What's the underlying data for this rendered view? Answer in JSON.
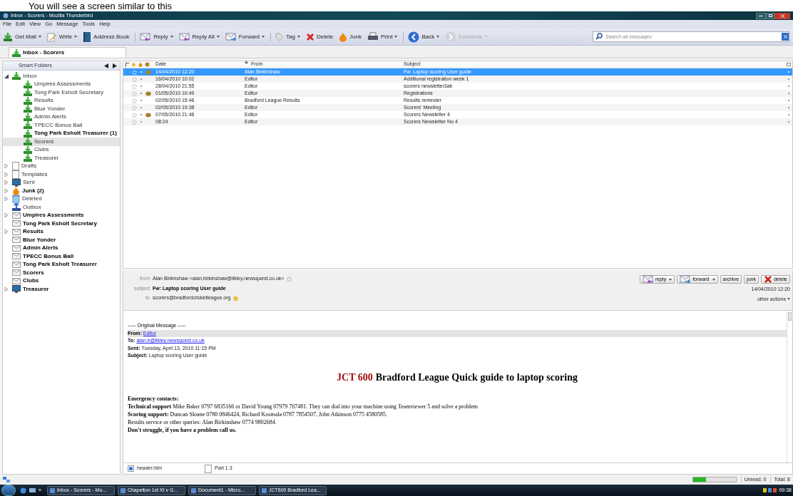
{
  "caption": "You will see a screen similar to this",
  "window": {
    "title": "Inbox - Scorers - Mozilla Thunderbird"
  },
  "menu": [
    "File",
    "Edit",
    "View",
    "Go",
    "Message",
    "Tools",
    "Help"
  ],
  "toolbar": [
    {
      "label": "Get Mail",
      "kind": "getmail",
      "dropdown": true,
      "disabled": false
    },
    {
      "label": "Write",
      "kind": "write",
      "dropdown": true,
      "disabled": false
    },
    {
      "label": "Address Book",
      "kind": "book",
      "dropdown": false,
      "disabled": false
    },
    {
      "label": "Reply",
      "kind": "reply",
      "dropdown": true,
      "disabled": false
    },
    {
      "label": "Reply All",
      "kind": "replyall",
      "dropdown": true,
      "disabled": false
    },
    {
      "label": "Forward",
      "kind": "forward",
      "dropdown": true,
      "disabled": false
    },
    {
      "label": "Tag",
      "kind": "tag",
      "dropdown": true,
      "disabled": false
    },
    {
      "label": "Delete",
      "kind": "delete",
      "dropdown": false,
      "disabled": false
    },
    {
      "label": "Junk",
      "kind": "junk",
      "dropdown": false,
      "disabled": false
    },
    {
      "label": "Print",
      "kind": "print",
      "dropdown": true,
      "disabled": false
    },
    {
      "label": "Back",
      "kind": "back",
      "dropdown": true,
      "disabled": false
    },
    {
      "label": "Forwards",
      "kind": "fwd",
      "dropdown": true,
      "disabled": true
    }
  ],
  "search": {
    "placeholder": "Search all messages"
  },
  "tabs": [
    {
      "label": "Inbox - Scorers",
      "selected": true
    }
  ],
  "folder_pane": {
    "title": "Smart Folders"
  },
  "folders": [
    {
      "name": "Inbox",
      "kind": "inbox",
      "bold": false,
      "selected": false,
      "expanded": true,
      "children": [
        {
          "name": "Umpires Assessments",
          "kind": "inbox",
          "bold": false,
          "selected": false
        },
        {
          "name": "Tong Park Esholt Secretary",
          "kind": "inbox",
          "bold": false,
          "selected": false
        },
        {
          "name": "Results",
          "kind": "inbox",
          "bold": false,
          "selected": false
        },
        {
          "name": "Blue Yonder",
          "kind": "inbox",
          "bold": false,
          "selected": false
        },
        {
          "name": "Admin Alerts",
          "kind": "inbox",
          "bold": false,
          "selected": false
        },
        {
          "name": "TPECC Bonus Ball",
          "kind": "inbox",
          "bold": false,
          "selected": false
        },
        {
          "name": "Tong Park Esholt Treasurer (1)",
          "kind": "inbox",
          "bold": true,
          "selected": false
        },
        {
          "name": "Scorers",
          "kind": "inbox",
          "bold": false,
          "selected": true
        },
        {
          "name": "Clubs",
          "kind": "inbox",
          "bold": false,
          "selected": false
        },
        {
          "name": "Treasurer",
          "kind": "inbox",
          "bold": false,
          "selected": false
        }
      ]
    },
    {
      "name": "Drafts",
      "kind": "page",
      "bold": false,
      "selected": false,
      "expanded": false
    },
    {
      "name": "Templates",
      "kind": "page",
      "bold": false,
      "selected": false,
      "expanded": false
    },
    {
      "name": "Sent",
      "kind": "sent",
      "bold": false,
      "selected": false,
      "expanded": false
    },
    {
      "name": "Junk (2)",
      "kind": "junk",
      "bold": true,
      "selected": false,
      "expanded": false
    },
    {
      "name": "Deleted",
      "kind": "trash",
      "bold": false,
      "selected": false,
      "expanded": false
    },
    {
      "name": "Outbox",
      "kind": "outbox",
      "bold": false,
      "selected": false
    },
    {
      "name": "Umpires Assessments",
      "kind": "mail",
      "bold": true,
      "selected": false,
      "expanded": false
    },
    {
      "name": "Tong Park Esholt Secretary",
      "kind": "mail",
      "bold": true,
      "selected": false
    },
    {
      "name": "Results",
      "kind": "mail",
      "bold": true,
      "selected": false,
      "expanded": false
    },
    {
      "name": "Blue Yonder",
      "kind": "mail",
      "bold": true,
      "selected": false
    },
    {
      "name": "Admin Alerts",
      "kind": "mail",
      "bold": true,
      "selected": false
    },
    {
      "name": "TPECC Bonus Ball",
      "kind": "mail",
      "bold": true,
      "selected": false
    },
    {
      "name": "Tong Park Esholt Treasurer",
      "kind": "mail",
      "bold": true,
      "selected": false
    },
    {
      "name": "Scorers",
      "kind": "mail",
      "bold": true,
      "selected": false
    },
    {
      "name": "Clubs",
      "kind": "mail",
      "bold": true,
      "selected": false
    },
    {
      "name": "Treasurer",
      "kind": "sent",
      "bold": true,
      "selected": false,
      "expanded": false
    }
  ],
  "message_list": {
    "columns": [
      "Date",
      "From",
      "Subject"
    ],
    "rows": [
      {
        "date": "14/04/2010 12:20",
        "from": "Alan Birkinshaw",
        "subject": "Fw: Laptop scoring User guide",
        "selected": true,
        "tagged": true
      },
      {
        "date": "16/04/2010 10:02",
        "from": "Editor",
        "subject": "Additional registration week 1",
        "selected": false,
        "tagged": false
      },
      {
        "date": "28/04/2010 21:55",
        "from": "Editor",
        "subject": "scorers newsletter3ab",
        "selected": false,
        "tagged": false
      },
      {
        "date": "01/05/2010 10:49",
        "from": "Editor",
        "subject": "Registrations",
        "selected": false,
        "tagged": true
      },
      {
        "date": "02/05/2010 15:46",
        "from": "Bradford League Results",
        "subject": "Results reminder",
        "selected": false,
        "tagged": false
      },
      {
        "date": "02/05/2010 19:38",
        "from": "Editor",
        "subject": "Scorers' Meeting",
        "selected": false,
        "tagged": false
      },
      {
        "date": "07/05/2010 21:46",
        "from": "Editor",
        "subject": "Scorers Newsletter 4",
        "selected": false,
        "tagged": true
      },
      {
        "date": "08:24",
        "from": "Editor",
        "subject": "Scorers Newsletter No 4",
        "selected": false,
        "tagged": false
      }
    ]
  },
  "header": {
    "fields": [
      {
        "label": "from",
        "value": "Alan Birkinshaw <alan.birkinshaw@ilkley.newsquest.co.uk>",
        "bold": false
      },
      {
        "label": "subject",
        "value": "Fw: Laptop scoring User guide",
        "bold": true
      },
      {
        "label": "to",
        "value": "scorers@bradfordcricketleague.org",
        "bold": false
      }
    ],
    "buttons": [
      {
        "label": "reply",
        "kind": "reply",
        "dropdown": true
      },
      {
        "label": "forward",
        "kind": "forward",
        "dropdown": true
      },
      {
        "label": "archive",
        "kind": "none",
        "dropdown": false
      },
      {
        "label": "junk",
        "kind": "none",
        "dropdown": false
      },
      {
        "label": "delete",
        "kind": "delete",
        "dropdown": false
      }
    ],
    "date": "14/04/2010 12:20",
    "other_actions": "other actions"
  },
  "body": {
    "separator": "----- Original Message -----",
    "fields": [
      {
        "label": "From:",
        "value": "Editor",
        "link": true
      },
      {
        "label": "To:",
        "value": "alan.b@ilkley.newsquest.co.uk",
        "link": true
      },
      {
        "label": "Sent:",
        "value": "Tuesday, April 13, 2010 11:15 PM",
        "link": false
      },
      {
        "label": "Subject:",
        "value": "Laptop scoring User guide",
        "link": false
      }
    ],
    "title_red": "JCT 600",
    "title": "Bradford League Quick guide to laptop scoring",
    "paragraphs": [
      "**Emergency contacts:**",
      "**Technical support** Mike Baker 0797 6835166 or David Young 07979 707481. They can dial into your machine using Teamviewer 5 and solve a problem",
      "**Scoring support:** Duncan Sloane 0780 0846424, Richard Kosmala  0787 7854507, John Atkinson  0775 4580585.",
      "Results service or other queries: Alan Birkinshaw 0774 9802684.",
      "**Don't struggle, if you have a problem call us.**"
    ]
  },
  "attachments": [
    {
      "name": "header.htm",
      "kind": "web"
    },
    {
      "name": "Part 1.3",
      "kind": "page"
    }
  ],
  "status_bar": {
    "level": 0.3,
    "unread": "Unread: 0",
    "total": "Total: 8"
  },
  "taskbar": {
    "overflow": "»",
    "items": [
      "Inbox - Scorers - Mo...",
      "Chapelton 1st XI v G...",
      "Document1 - Micro...",
      "JCT600 Bradford Lea..."
    ],
    "clock": "09:38"
  }
}
